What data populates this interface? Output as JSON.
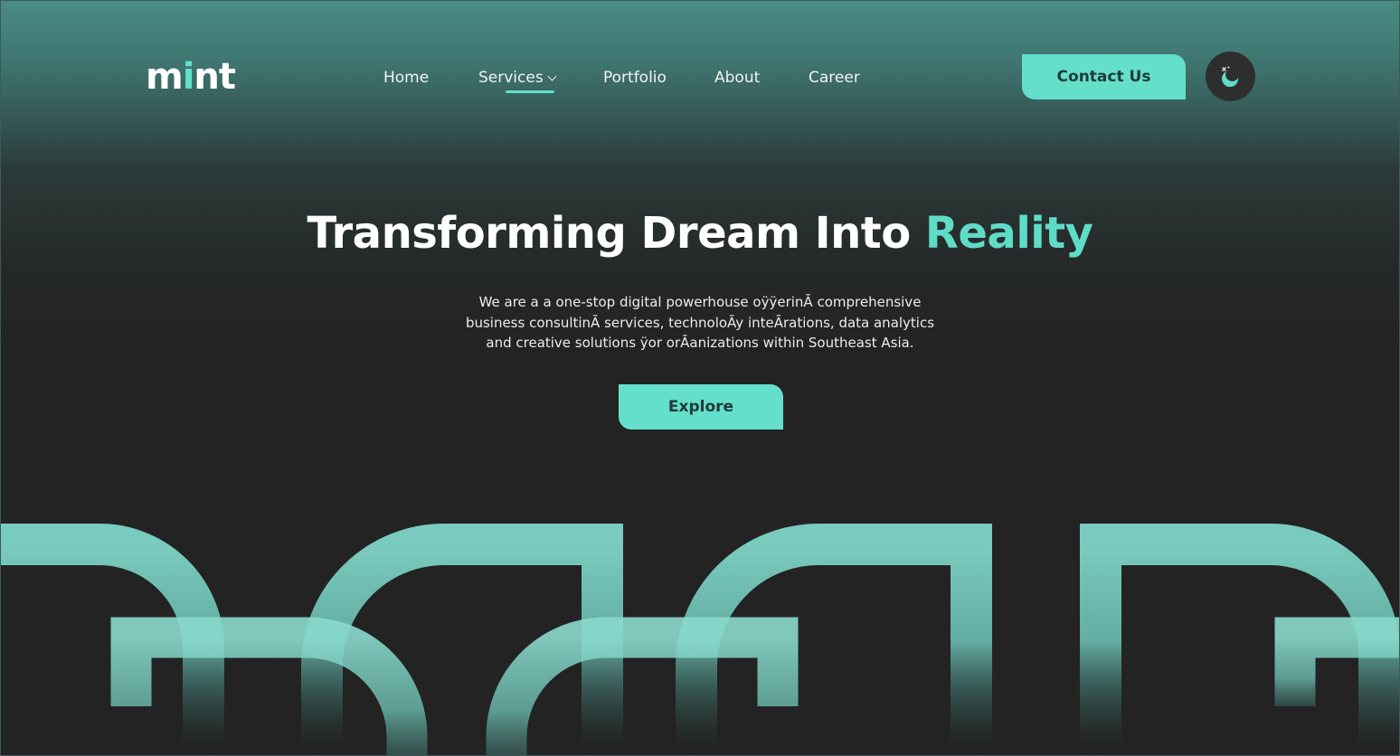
{
  "brand": {
    "logo_prefix": "m",
    "logo_accent": "i",
    "logo_suffix": "nt",
    "accent_color": "#63dfca"
  },
  "nav": {
    "items": [
      {
        "label": "Home"
      },
      {
        "label": "Services",
        "has_dropdown": true,
        "active": true
      },
      {
        "label": "Portfolio"
      },
      {
        "label": "About"
      },
      {
        "label": "Career"
      }
    ]
  },
  "header": {
    "contact_label": "Contact Us",
    "theme_toggle_icon": "moon-stars-icon"
  },
  "hero": {
    "title_main": "Transforming Dream Into ",
    "title_accent": "Reality",
    "description_lines": [
      "We are a a one-stop digital powerhouse oÿÿerinĀ comprehensive",
      "business consultinĀ services, technoloĀy inteĀrations, data analytics",
      "and creative solutions ÿor orĀanizations within Southeast Asia."
    ],
    "explore_label": "Explore"
  },
  "colors": {
    "background": "#232323",
    "header_gradient_top": "#4a8c84",
    "button_fill": "#63dfca",
    "button_text": "#1f3a36",
    "decor_teal": "#7fd4c7"
  }
}
